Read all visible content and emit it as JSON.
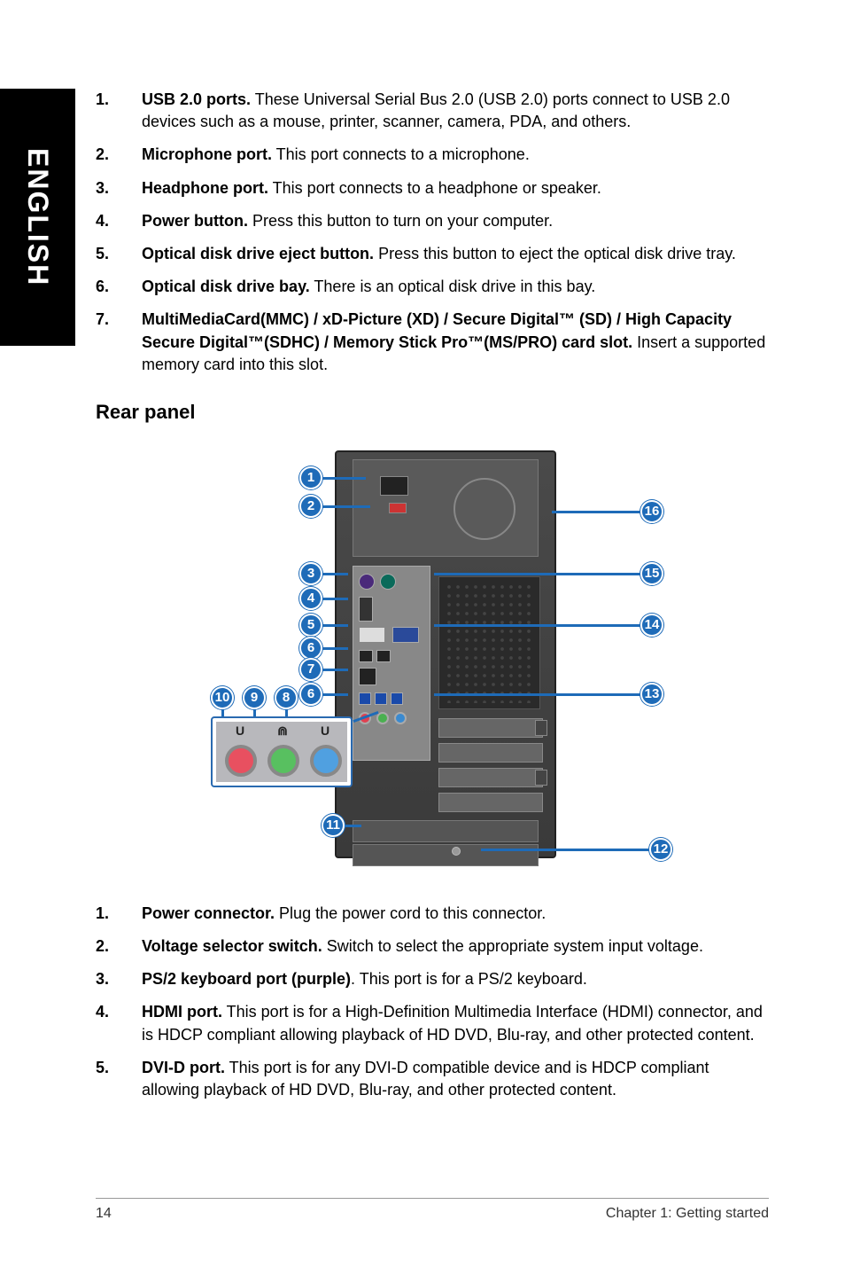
{
  "side_tab": "ENGLISH",
  "list_top": [
    {
      "n": "1.",
      "bold": "USB 2.0 ports.",
      "text": " These Universal Serial Bus 2.0 (USB 2.0) ports connect to USB 2.0 devices such as a mouse, printer, scanner, camera, PDA, and others."
    },
    {
      "n": "2.",
      "bold": "Microphone port.",
      "text": " This port connects to a microphone."
    },
    {
      "n": "3.",
      "bold": "Headphone port.",
      "text": " This port connects to a headphone or speaker."
    },
    {
      "n": "4.",
      "bold": "Power button.",
      "text": " Press this button to turn on your computer."
    },
    {
      "n": "5.",
      "bold": "Optical disk drive eject button.",
      "text": " Press this button to eject the optical disk drive tray."
    },
    {
      "n": "6.",
      "bold": "Optical disk drive bay.",
      "text": " There is an optical disk drive in this bay."
    },
    {
      "n": "7.",
      "bold": "MultiMediaCard(MMC) / xD-Picture (XD) / Secure Digital™ (SD) / High Capacity Secure Digital™(SDHC) / Memory Stick Pro™(MS/PRO) card slot.",
      "text": " Insert a supported memory card into this slot."
    }
  ],
  "heading": "Rear panel",
  "callouts_left": [
    "1",
    "2",
    "3",
    "4",
    "5",
    "6",
    "7",
    "6",
    "10",
    "9",
    "8",
    "11"
  ],
  "callouts_right": [
    "16",
    "15",
    "14",
    "13",
    "12"
  ],
  "list_bottom": [
    {
      "n": "1.",
      "bold": "Power connector.",
      "text": " Plug the power cord to this connector."
    },
    {
      "n": "2.",
      "bold": "Voltage selector switch.",
      "text": " Switch to select the appropriate system input voltage."
    },
    {
      "n": "3.",
      "bold": "PS/2 keyboard port (purple)",
      "text": ". This port is for a PS/2 keyboard."
    },
    {
      "n": "4.",
      "bold": "HDMI port.",
      "text": " This port is for a High-Definition Multimedia Interface (HDMI) connector, and is HDCP compliant allowing playback of HD DVD, Blu-ray, and other protected content."
    },
    {
      "n": "5.",
      "bold": "DVI-D port.",
      "text": " This port is for any DVI-D compatible device and is HDCP compliant allowing playback of HD DVD, Blu-ray, and other protected content."
    }
  ],
  "footer": {
    "page": "14",
    "chapter": "Chapter 1: Getting started"
  }
}
